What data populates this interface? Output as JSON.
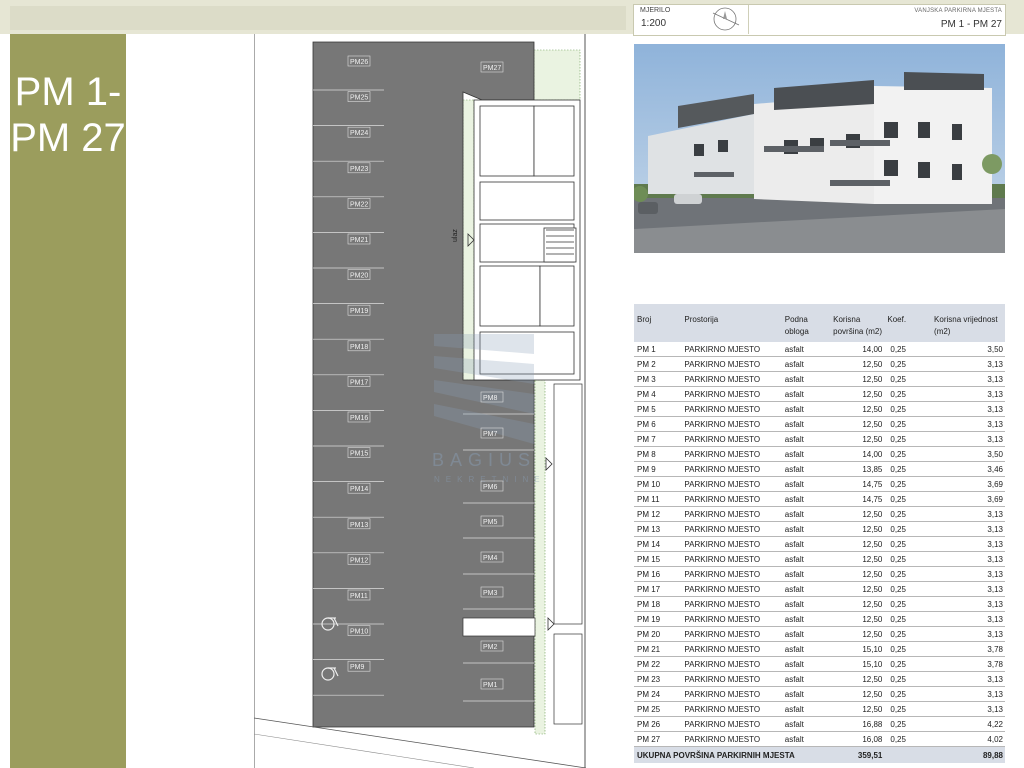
{
  "header": {
    "scale_label": "MJERILO",
    "scale_value": "1:200",
    "sheet_label": "VANJSKA PARKIRNA MJESTA",
    "sheet_value": "PM 1 - PM 27"
  },
  "side_banner": {
    "line1": "PM 1-",
    "line2": "PM 27"
  },
  "plan": {
    "left_labels": [
      "PM26",
      "PM25",
      "PM24",
      "PM23",
      "PM22",
      "PM21",
      "PM20",
      "PM19",
      "PM18",
      "PM17",
      "PM16",
      "PM15",
      "PM14",
      "PM13",
      "PM12",
      "PM11",
      "PM10",
      "PM9"
    ],
    "right_labels": [
      "PM27",
      "PM8",
      "PM7",
      "PM6",
      "PM5",
      "PM4",
      "PM3",
      "PM2",
      "PM1"
    ],
    "entrance_label": "ulaz",
    "watermark_main": "BAGIUS",
    "watermark_sub": "NEKRETNINE"
  },
  "table": {
    "headers": [
      "Broj",
      "Prostorija",
      "Podna obloga",
      "Korisna površina (m2)",
      "Koef.",
      "Korisna vrijednost (m2)"
    ],
    "rows": [
      [
        "PM 1",
        "PARKIRNO MJESTO",
        "asfalt",
        "14,00",
        "0,25",
        "3,50"
      ],
      [
        "PM 2",
        "PARKIRNO MJESTO",
        "asfalt",
        "12,50",
        "0,25",
        "3,13"
      ],
      [
        "PM 3",
        "PARKIRNO MJESTO",
        "asfalt",
        "12,50",
        "0,25",
        "3,13"
      ],
      [
        "PM 4",
        "PARKIRNO MJESTO",
        "asfalt",
        "12,50",
        "0,25",
        "3,13"
      ],
      [
        "PM 5",
        "PARKIRNO MJESTO",
        "asfalt",
        "12,50",
        "0,25",
        "3,13"
      ],
      [
        "PM 6",
        "PARKIRNO MJESTO",
        "asfalt",
        "12,50",
        "0,25",
        "3,13"
      ],
      [
        "PM 7",
        "PARKIRNO MJESTO",
        "asfalt",
        "12,50",
        "0,25",
        "3,13"
      ],
      [
        "PM 8",
        "PARKIRNO MJESTO",
        "asfalt",
        "14,00",
        "0,25",
        "3,50"
      ],
      [
        "PM 9",
        "PARKIRNO MJESTO",
        "asfalt",
        "13,85",
        "0,25",
        "3,46"
      ],
      [
        "PM 10",
        "PARKIRNO MJESTO",
        "asfalt",
        "14,75",
        "0,25",
        "3,69"
      ],
      [
        "PM 11",
        "PARKIRNO MJESTO",
        "asfalt",
        "14,75",
        "0,25",
        "3,69"
      ],
      [
        "PM 12",
        "PARKIRNO MJESTO",
        "asfalt",
        "12,50",
        "0,25",
        "3,13"
      ],
      [
        "PM 13",
        "PARKIRNO MJESTO",
        "asfalt",
        "12,50",
        "0,25",
        "3,13"
      ],
      [
        "PM 14",
        "PARKIRNO MJESTO",
        "asfalt",
        "12,50",
        "0,25",
        "3,13"
      ],
      [
        "PM 15",
        "PARKIRNO MJESTO",
        "asfalt",
        "12,50",
        "0,25",
        "3,13"
      ],
      [
        "PM 16",
        "PARKIRNO MJESTO",
        "asfalt",
        "12,50",
        "0,25",
        "3,13"
      ],
      [
        "PM 17",
        "PARKIRNO MJESTO",
        "asfalt",
        "12,50",
        "0,25",
        "3,13"
      ],
      [
        "PM 18",
        "PARKIRNO MJESTO",
        "asfalt",
        "12,50",
        "0,25",
        "3,13"
      ],
      [
        "PM 19",
        "PARKIRNO MJESTO",
        "asfalt",
        "12,50",
        "0,25",
        "3,13"
      ],
      [
        "PM 20",
        "PARKIRNO MJESTO",
        "asfalt",
        "12,50",
        "0,25",
        "3,13"
      ],
      [
        "PM 21",
        "PARKIRNO MJESTO",
        "asfalt",
        "15,10",
        "0,25",
        "3,78"
      ],
      [
        "PM 22",
        "PARKIRNO MJESTO",
        "asfalt",
        "15,10",
        "0,25",
        "3,78"
      ],
      [
        "PM 23",
        "PARKIRNO MJESTO",
        "asfalt",
        "12,50",
        "0,25",
        "3,13"
      ],
      [
        "PM 24",
        "PARKIRNO MJESTO",
        "asfalt",
        "12,50",
        "0,25",
        "3,13"
      ],
      [
        "PM 25",
        "PARKIRNO MJESTO",
        "asfalt",
        "12,50",
        "0,25",
        "3,13"
      ],
      [
        "PM 26",
        "PARKIRNO MJESTO",
        "asfalt",
        "16,88",
        "0,25",
        "4,22"
      ],
      [
        "PM 27",
        "PARKIRNO MJESTO",
        "asfalt",
        "16,08",
        "0,25",
        "4,02"
      ]
    ],
    "total": {
      "label": "UKUPNA POVRŠINA PARKIRNIH MJESTA",
      "area": "359,51",
      "value": "89,88"
    }
  },
  "colors": {
    "side_banner": "#9b9d5d",
    "header_band": "#e6e6d4",
    "parking": "#777777",
    "table_header": "#d8dde6"
  }
}
